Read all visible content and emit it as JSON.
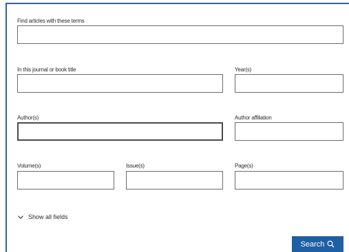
{
  "form": {
    "terms": {
      "label": "Find articles with these terms",
      "value": ""
    },
    "journal": {
      "label": "In this journal or book title",
      "value": ""
    },
    "years": {
      "label": "Year(s)",
      "value": ""
    },
    "authors": {
      "label": "Author(s)",
      "value": ""
    },
    "affiliation": {
      "label": "Author affiliation",
      "value": ""
    },
    "volumes": {
      "label": "Volume(s)",
      "value": ""
    },
    "issues": {
      "label": "Issue(s)",
      "value": ""
    },
    "pages": {
      "label": "Page(s)",
      "value": ""
    }
  },
  "show_all_fields": {
    "label": "Show all fields",
    "icon": "chevron-down-icon"
  },
  "search_button": {
    "label": "Search",
    "icon": "search-icon"
  },
  "colors": {
    "accent": "#1f5fa3",
    "frame": "#2f5fa8"
  }
}
